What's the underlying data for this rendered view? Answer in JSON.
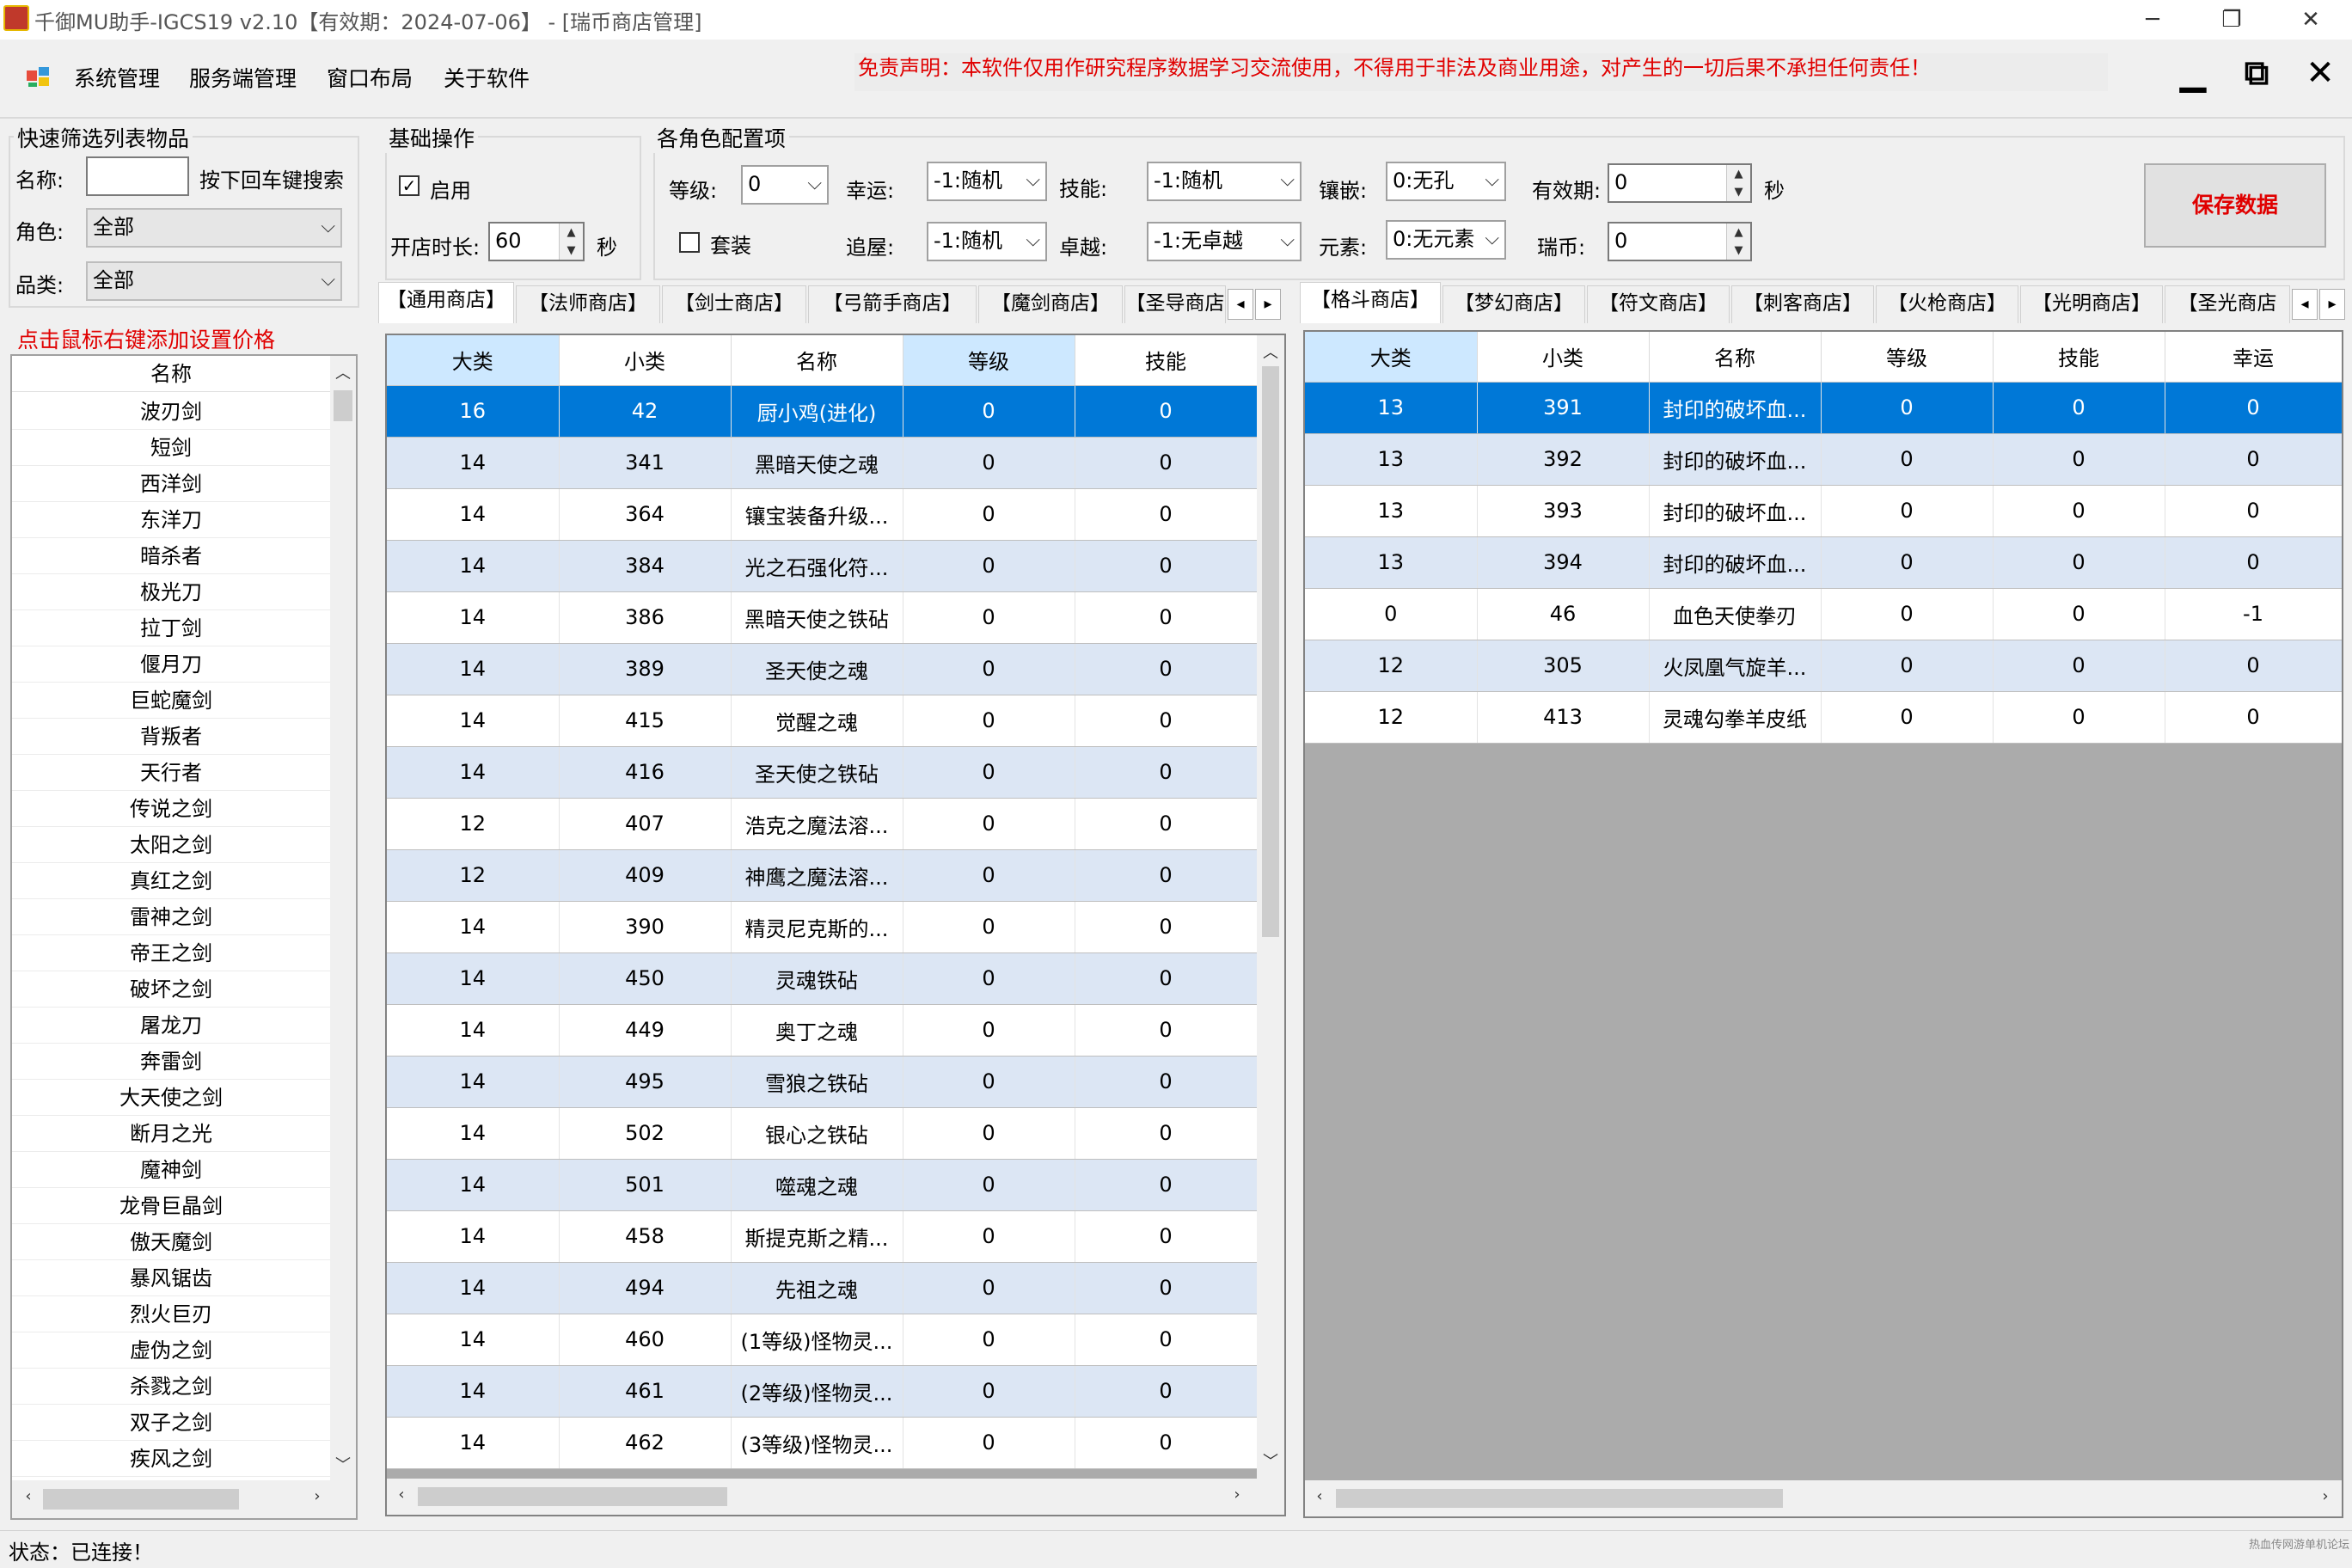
{
  "window": {
    "title": "千御MU助手-IGCS19 v2.10【有效期：2024-07-06】 - [瑞币商店管理]",
    "minimize": "─",
    "restore": "❐",
    "close": "✕"
  },
  "menu": {
    "items": [
      "系统管理",
      "服务端管理",
      "窗口布局",
      "关于软件"
    ],
    "disclaimer": "免责声明：本软件仅用作研究程序数据学习交流使用，不得用于非法及商业用途，对产生的一切后果不承担任何责任！",
    "mdi_min": "▁",
    "mdi_restore": "⧉",
    "mdi_close": "✕"
  },
  "filter": {
    "title": "快速筛选列表物品",
    "name_label": "名称:",
    "name_value": "",
    "search_hint": "按下回车键搜索",
    "role_label": "角色:",
    "role_value": "全部",
    "category_label": "品类:",
    "category_value": "全部"
  },
  "basic": {
    "title": "基础操作",
    "enable_label": "启用",
    "enable_checked": true,
    "duration_label": "开店时长:",
    "duration_value": "60",
    "duration_unit": "秒"
  },
  "roleconfig": {
    "title": "各角色配置项",
    "level_label": "等级:",
    "level_value": "0",
    "set_label": "套装",
    "luck_label": "幸运:",
    "luck_value": "-1:随机",
    "append_label": "追屋:",
    "append_value": "-1:随机",
    "skill_label": "技能:",
    "skill_value": "-1:随机",
    "excellent_label": "卓越:",
    "excellent_value": "-1:无卓越",
    "socket_label": "镶嵌:",
    "socket_value": "0:无孔",
    "element_label": "元素:",
    "element_value": "0:无元素",
    "expire_label": "有效期:",
    "expire_value": "0",
    "expire_unit": "秒",
    "coin_label": "瑞币:",
    "coin_value": "0"
  },
  "save_button": "保存数据",
  "left_list": {
    "hint": "点击鼠标右键添加设置价格",
    "header": "名称",
    "items": [
      "波刃剑",
      "短剑",
      "西洋剑",
      "东洋刀",
      "暗杀者",
      "极光刀",
      "拉丁剑",
      "偃月刀",
      "巨蛇魔剑",
      "背叛者",
      "天行者",
      "传说之剑",
      "太阳之剑",
      "真红之剑",
      "雷神之剑",
      "帝王之剑",
      "破坏之剑",
      "屠龙刀",
      "奔雷剑",
      "大天使之剑",
      "断月之光",
      "魔神剑",
      "龙骨巨晶剑",
      "傲天魔剑",
      "暴风锯齿",
      "烈火巨刃",
      "虚伪之剑",
      "杀戮之剑",
      "双子之剑",
      "疾风之剑"
    ]
  },
  "left_tabs": {
    "tabs": [
      "【通用商店】",
      "【法师商店】",
      "【剑士商店】",
      "【弓箭手商店】",
      "【魔剑商店】",
      "【圣导商店"
    ],
    "active": 0
  },
  "right_tabs": {
    "tabs": [
      "【格斗商店】",
      "【梦幻商店】",
      "【符文商店】",
      "【刺客商店】",
      "【火枪商店】",
      "【光明商店】",
      "【圣光商店"
    ],
    "active": 0
  },
  "left_grid": {
    "columns": [
      "大类",
      "小类",
      "名称",
      "等级",
      "技能"
    ],
    "rows": [
      [
        "16",
        "42",
        "厨小鸡(进化)",
        "0",
        "0"
      ],
      [
        "14",
        "341",
        "黑暗天使之魂",
        "0",
        "0"
      ],
      [
        "14",
        "364",
        "镶宝装备升级...",
        "0",
        "0"
      ],
      [
        "14",
        "384",
        "光之石强化符...",
        "0",
        "0"
      ],
      [
        "14",
        "386",
        "黑暗天使之铁砧",
        "0",
        "0"
      ],
      [
        "14",
        "389",
        "圣天使之魂",
        "0",
        "0"
      ],
      [
        "14",
        "415",
        "觉醒之魂",
        "0",
        "0"
      ],
      [
        "14",
        "416",
        "圣天使之铁砧",
        "0",
        "0"
      ],
      [
        "12",
        "407",
        "浩克之魔法溶...",
        "0",
        "0"
      ],
      [
        "12",
        "409",
        "神鹰之魔法溶...",
        "0",
        "0"
      ],
      [
        "14",
        "390",
        "精灵尼克斯的...",
        "0",
        "0"
      ],
      [
        "14",
        "450",
        "灵魂铁砧",
        "0",
        "0"
      ],
      [
        "14",
        "449",
        "奥丁之魂",
        "0",
        "0"
      ],
      [
        "14",
        "495",
        "雪狼之铁砧",
        "0",
        "0"
      ],
      [
        "14",
        "502",
        "银心之铁砧",
        "0",
        "0"
      ],
      [
        "14",
        "501",
        "噬魂之魂",
        "0",
        "0"
      ],
      [
        "14",
        "458",
        "斯提克斯之精...",
        "0",
        "0"
      ],
      [
        "14",
        "494",
        "先祖之魂",
        "0",
        "0"
      ],
      [
        "14",
        "460",
        "(1等级)怪物灵...",
        "0",
        "0"
      ],
      [
        "14",
        "461",
        "(2等级)怪物灵...",
        "0",
        "0"
      ],
      [
        "14",
        "462",
        "(3等级)怪物灵...",
        "0",
        "0"
      ]
    ]
  },
  "right_grid": {
    "columns": [
      "大类",
      "小类",
      "名称",
      "等级",
      "技能",
      "幸运"
    ],
    "rows": [
      [
        "13",
        "391",
        "封印的破坏血...",
        "0",
        "0",
        "0"
      ],
      [
        "13",
        "392",
        "封印的破坏血...",
        "0",
        "0",
        "0"
      ],
      [
        "13",
        "393",
        "封印的破坏血...",
        "0",
        "0",
        "0"
      ],
      [
        "13",
        "394",
        "封印的破坏血...",
        "0",
        "0",
        "0"
      ],
      [
        "0",
        "46",
        "血色天使拳刃",
        "0",
        "0",
        "-1"
      ],
      [
        "12",
        "305",
        "火凤凰气旋羊...",
        "0",
        "0",
        "0"
      ],
      [
        "12",
        "413",
        "灵魂勾拳羊皮纸",
        "0",
        "0",
        "0"
      ]
    ]
  },
  "status": {
    "text": "状态：已连接！",
    "watermark": "热血传网游单机论坛"
  }
}
